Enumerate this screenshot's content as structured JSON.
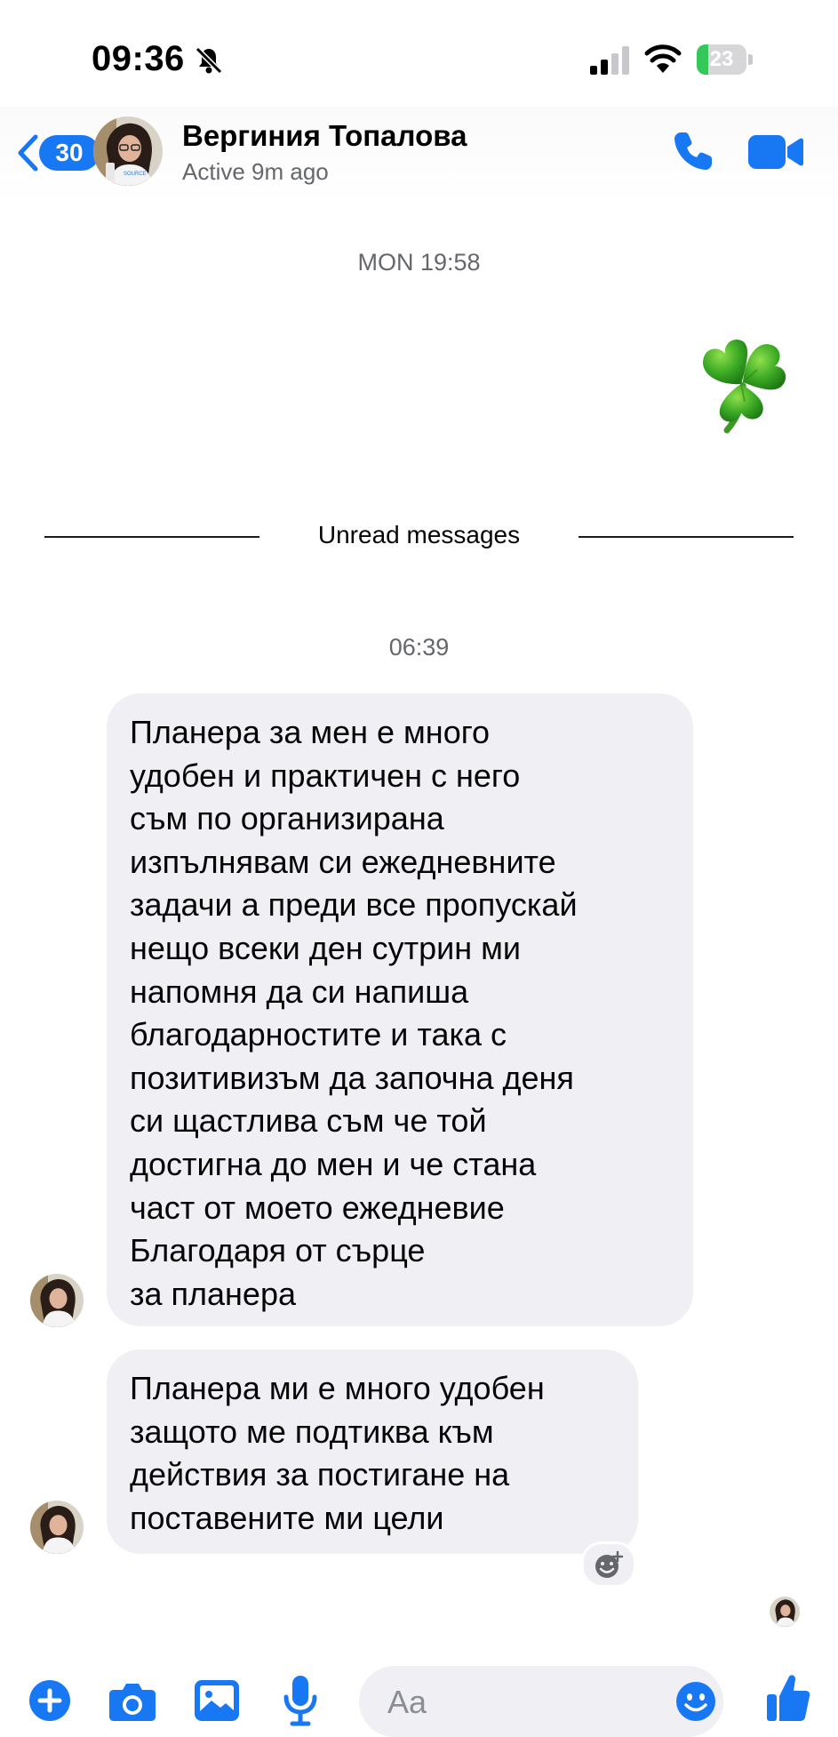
{
  "status_bar": {
    "time": "09:36",
    "battery_level": "23",
    "battery_fraction": 0.23,
    "icons": [
      "bell-slash-icon",
      "cellular-signal-icon",
      "wifi-icon",
      "battery-charging-icon"
    ]
  },
  "header": {
    "unread_count": "30",
    "contact_name": "Вергиния Топалова",
    "contact_status": "Active 9m ago",
    "icons": [
      "back-chevron-icon",
      "phone-icon",
      "video-camera-icon"
    ],
    "accent_color": "#1877f2"
  },
  "chat": {
    "timestamp_1": "MON 19:58",
    "sticker": "shamrock-sticker",
    "unread_divider_label": "Unread messages",
    "timestamp_2": "06:39",
    "messages": [
      {
        "text": "Планера за мен е много\nудобен и практичен с него\nсъм по организирана\nизпълнявам си ежедневните\nзадачи а преди все пропускай\nнещо всеки ден сутрин ми\nнапомня да си напиша\nблагодарностите и така с\nпозитивизъм да започна деня\nси щастлива съм че той\nдостигна до мен и че стана\nчаст от моето ежедневие\nБлагодаря от сърце\nза планера"
      },
      {
        "text": "Планера ми е много удобен\nзащото ме подтиква към\nдействия за постигане на\nпоставените ми цели"
      }
    ],
    "bubble_color": "#f0f0f4"
  },
  "composer": {
    "placeholder": "Aa",
    "icons": [
      "plus-icon",
      "camera-icon",
      "gallery-icon",
      "microphone-icon",
      "emoji-icon",
      "thumbs-up-icon"
    ]
  }
}
